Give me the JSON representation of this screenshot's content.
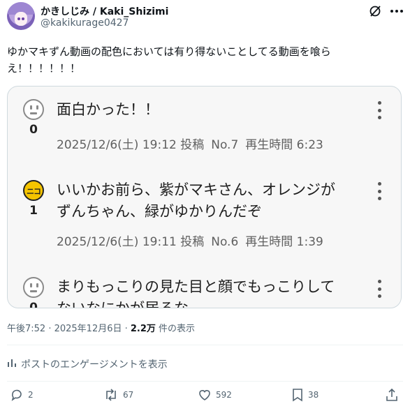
{
  "header": {
    "display_name": "かきしじみ / Kaki_Shizimi",
    "handle": "@kakikurage0427"
  },
  "tweet": {
    "text": "ゆかマキずん動画の配色においては有り得ないことしてる動画を喰らえ！！！！！！"
  },
  "card": {
    "comments": [
      {
        "face": "neutral-face-icon",
        "count": "0",
        "lines": [
          "面白かった！！"
        ],
        "date": "2025/12/6(土) 19:12 投稿",
        "number": "No.7",
        "playtime": "再生時間 6:23"
      },
      {
        "face": "niko-face-icon",
        "count": "1",
        "lines": [
          "いいかお前ら、紫がマキさん、オレンジが",
          "ずんちゃん、緑がゆかりんだぞ"
        ],
        "date": "2025/12/6(土) 19:11 投稿",
        "number": "No.6",
        "playtime": "再生時間 1:39"
      },
      {
        "face": "neutral-face-icon",
        "count": "0",
        "lines": [
          "まりもっこりの見た目と顔でもっこりして",
          "ないなにかが居るな"
        ]
      }
    ]
  },
  "footer": {
    "time": "午後7:52 · 2025年12月6日 · ",
    "views_count": "2.2万",
    "views_label": " 件の表示"
  },
  "analytics": {
    "label": "ポストのエンゲージメントを表示"
  },
  "actions": {
    "replies": "2",
    "reposts": "67",
    "likes": "592",
    "bookmarks": "38"
  },
  "colors": {
    "text": "#0f1419",
    "secondary": "#536471",
    "card_bg": "#f7f7f7",
    "niko_yellow": "#f5c400"
  }
}
